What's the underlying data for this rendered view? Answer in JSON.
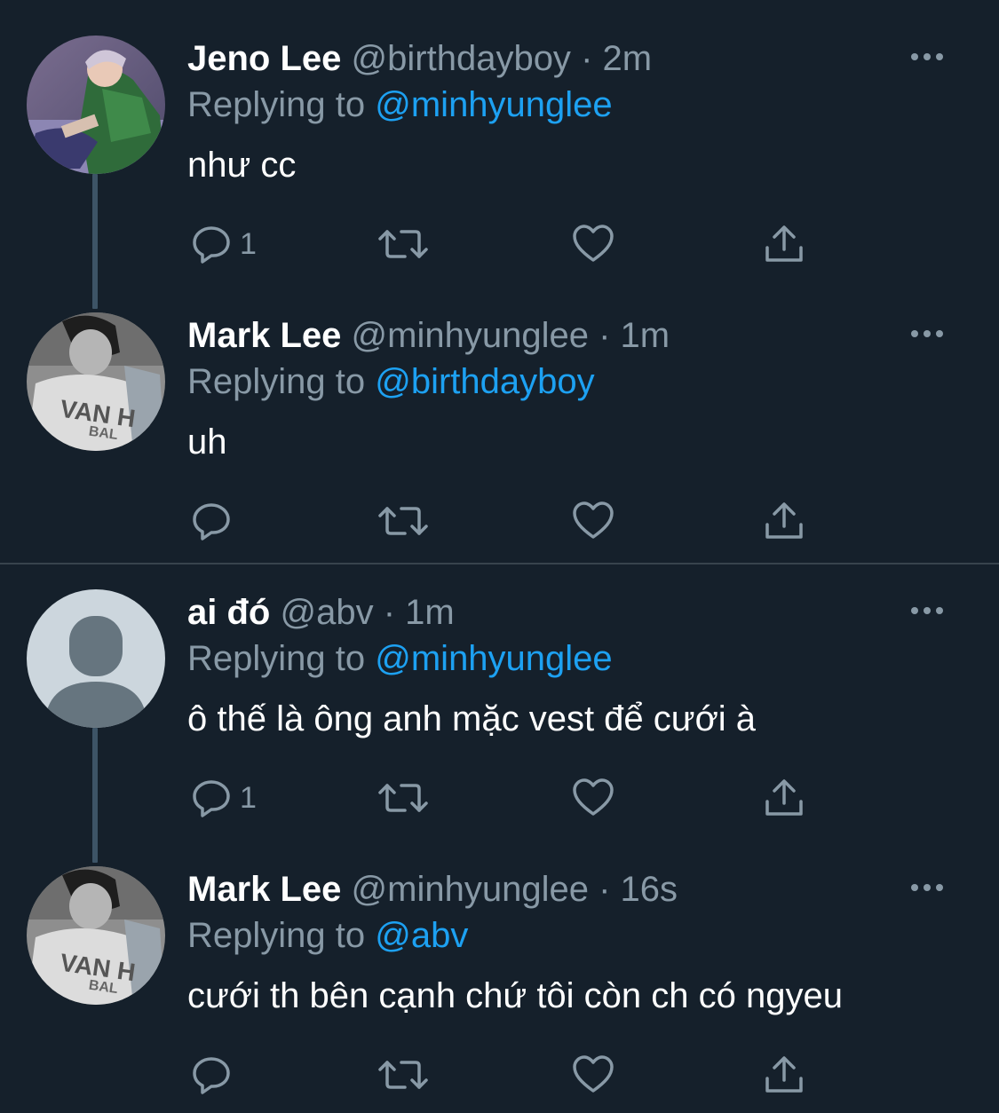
{
  "tweets": [
    {
      "name": "Jeno Lee",
      "handle": "@birthdayboy",
      "separator": "·",
      "time": "2m",
      "replying_prefix": "Replying to",
      "replying_to": "@minhyunglee",
      "text": "như cc",
      "reply_count": "1",
      "avatar": "photo-avatar-green-jacket"
    },
    {
      "name": "Mark Lee",
      "handle": "@minhyunglee",
      "separator": "·",
      "time": "1m",
      "replying_prefix": "Replying to",
      "replying_to": "@birthdayboy",
      "text": "uh",
      "reply_count": "",
      "avatar": "photo-avatar-monochrome"
    },
    {
      "name": "ai đó",
      "handle": "@abv",
      "separator": "·",
      "time": "1m",
      "replying_prefix": "Replying to",
      "replying_to": "@minhyunglee",
      "text": "ô thế là ông anh mặc vest để cưới à",
      "reply_count": "1",
      "avatar": "default-profile-avatar"
    },
    {
      "name": "Mark Lee",
      "handle": "@minhyunglee",
      "separator": "·",
      "time": "16s",
      "replying_prefix": "Replying to",
      "replying_to": "@abv",
      "text": "cưới th bên cạnh chứ tôi còn ch có ngyeu",
      "reply_count": "",
      "avatar": "photo-avatar-monochrome"
    }
  ],
  "colors": {
    "background": "#15202b",
    "text_primary": "#ffffff",
    "text_secondary": "#8899a6",
    "accent": "#1da1f2",
    "thread_line": "#3d5466",
    "divider": "#38444d"
  },
  "icons": [
    "reply-icon",
    "retweet-icon",
    "like-icon",
    "share-icon",
    "more-options-icon"
  ]
}
